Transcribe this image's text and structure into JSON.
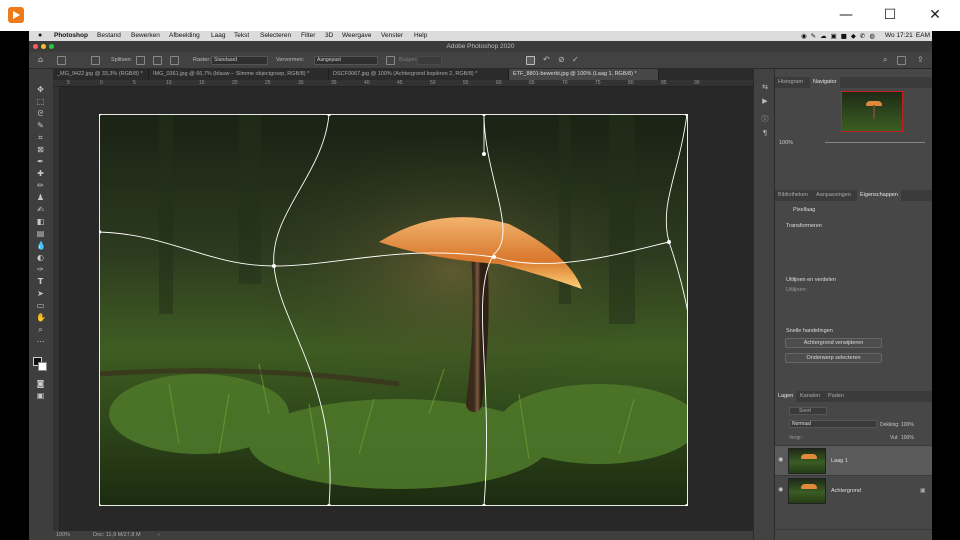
{
  "window": {
    "app_icon": "play-icon",
    "minimize": "—",
    "maximize": "☐",
    "close": "✕"
  },
  "menubar": {
    "apple": "",
    "items": [
      "Photoshop",
      "Bestand",
      "Bewerken",
      "Afbeelding",
      "Laag",
      "Tekst",
      "Selecteren",
      "Filter",
      "3D",
      "Weergave",
      "Venster",
      "Help"
    ],
    "clock": "Wo 17:21",
    "user": "EAM"
  },
  "app_title": "Adobe Photoshop 2020",
  "options_bar": {
    "split_label": "Splitsen:",
    "grid_label": "Raster:",
    "grid_value": "Standaard",
    "warp_label": "Vervormen:",
    "warp_value": "Aangepast",
    "bend_label": "Buigen:"
  },
  "tabs": [
    "_MG_9422.jpg @ 33,3% (RGB/8) *",
    "IMG_0361.jpg @ 66,7% (blauw – Slimme objectgroep, RGB/8) *",
    "DSCF0067.jpg @ 100% (Achtergrond kopiëren 2, RGB/8) *",
    "ETF_8801-bewerkt.jpg @ 100% (Laag 1, RGB/8) *"
  ],
  "active_tab_index": 3,
  "ruler_ticks": [
    "5",
    "0",
    "5",
    "10",
    "15",
    "20",
    "25",
    "30",
    "35",
    "40",
    "45",
    "50",
    "55",
    "60",
    "65",
    "70",
    "75",
    "80",
    "85",
    "90"
  ],
  "status": {
    "zoom": "100%",
    "doc": "Doc: 11,9 M/27,8 M"
  },
  "navigator": {
    "tabs": [
      "Histogram",
      "Navigator"
    ],
    "active": "Navigator",
    "zoom": "100%"
  },
  "properties": {
    "tabs": [
      "Bibliotheken",
      "Aanpassingen",
      "Eigenschappen"
    ],
    "active": "Eigenschappen",
    "pixel_layer": "Pixellaag",
    "transform_section": "Transformeren",
    "align_section": "Uitlijnen en verdelen",
    "align_label": "Uitlijnen:",
    "quick_actions_section": "Snelle handelingen",
    "remove_bg_button": "Achtergrond verwijderen",
    "select_subject_button": "Onderwerp selecteren"
  },
  "layers_panel": {
    "tabs": [
      "Lagen",
      "Kanalen",
      "Paden"
    ],
    "active": "Lagen",
    "kind_filter": "Soort",
    "blend_mode": "Normaal",
    "opacity_label": "Dekking:",
    "opacity_value": "100%",
    "lock_label": "Vergr.:",
    "fill_label": "Vul:",
    "fill_value": "100%",
    "layers": [
      {
        "name": "Laag 1",
        "selected": true
      },
      {
        "name": "Achtergrond",
        "selected": false
      }
    ]
  },
  "colors": {
    "accent_orange": "#e0893a",
    "panel_bg": "#474747",
    "canvas_bg": "#282828"
  }
}
